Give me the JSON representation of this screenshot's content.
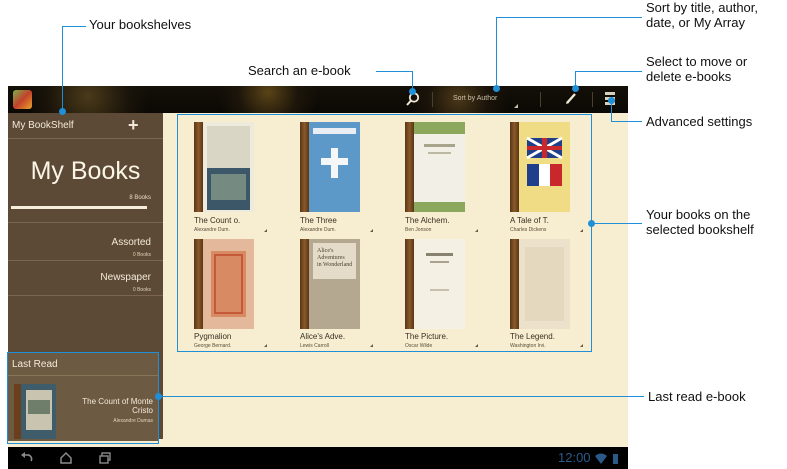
{
  "callouts": {
    "bookshelves": "Your bookshelves",
    "search": "Search an e-book",
    "sort": [
      "Sort by title, author,",
      "date, or My Array"
    ],
    "select": [
      "Select to move or",
      "delete e-books"
    ],
    "advanced": "Advanced settings",
    "books_on_shelf": [
      "Your books on the",
      "selected bookshelf"
    ],
    "last_read": "Last read e-book"
  },
  "toolbar": {
    "sort_label": "Sort by Author",
    "icons": [
      "app-logo-icon",
      "search-icon",
      "pencil-icon",
      "menu-icon"
    ]
  },
  "sidebar": {
    "title": "My BookShelf",
    "add_icon": "+",
    "main_shelf": {
      "label": "My Books",
      "count": "8 Books"
    },
    "shelves": [
      {
        "label": "Assorted",
        "count": "0 Books"
      },
      {
        "label": "Newspaper",
        "count": "0 Books"
      }
    ]
  },
  "last_read": {
    "title": "Last Read",
    "book_title": "The Count of Monte Cristo",
    "author": "Alexandre Dumas"
  },
  "books": [
    {
      "title": "The Count o.",
      "author": "Alexandre Dum."
    },
    {
      "title": "The Three",
      "author": "Alexandre Dum."
    },
    {
      "title": "The Alchem.",
      "author": "Ben Jonson"
    },
    {
      "title": "A Tale of T.",
      "author": "Charles Dickens"
    },
    {
      "title": "Pygmalion",
      "author": "George Bernard."
    },
    {
      "title": "Alice's Adve.",
      "author": "Lewis Carroll"
    },
    {
      "title": "The Picture.",
      "author": "Oscar Wilde"
    },
    {
      "title": "The Legend.",
      "author": "Washington Irvi."
    }
  ],
  "book_cover_text": {
    "alice": [
      "Alice's",
      "Adventures",
      "in Wonderland"
    ]
  },
  "status_bar": {
    "clock": "12:00",
    "nav_icons": [
      "back-icon",
      "home-icon",
      "recent-apps-icon"
    ]
  },
  "colors": {
    "accent": "#1f8fd8",
    "shelf_bg": "#f7eed2",
    "sidebar_bg": "#5c4a36"
  }
}
